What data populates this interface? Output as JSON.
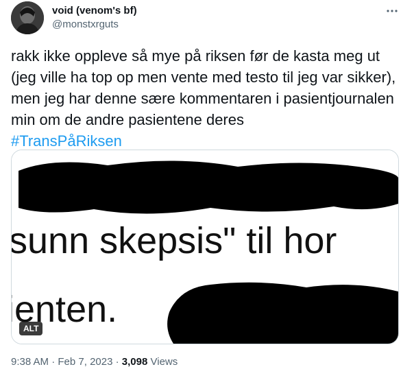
{
  "author": {
    "display_name": "void (venom's bf)",
    "handle": "@monstxrguts"
  },
  "tweet": {
    "text_lines": [
      "rakk ikke oppleve så mye på riksen før de kasta meg",
      "ut (jeg ville ha top op men vente med testo til jeg var",
      "sikker), men jeg har denne sære kommentaren i",
      "pasientjournalen min om de andre pasientene deres"
    ],
    "hashtag": "#TransPåRiksen"
  },
  "media": {
    "image_text_line1": "sunn skepsis\" til hor",
    "image_text_line2": "ienten.",
    "alt_badge": "ALT"
  },
  "meta": {
    "time": "9:38 AM",
    "separator": "·",
    "date": "Feb 7, 2023",
    "views_count": "3,098",
    "views_label": "Views"
  },
  "icons": {
    "more": "more-horizontal-icon"
  }
}
